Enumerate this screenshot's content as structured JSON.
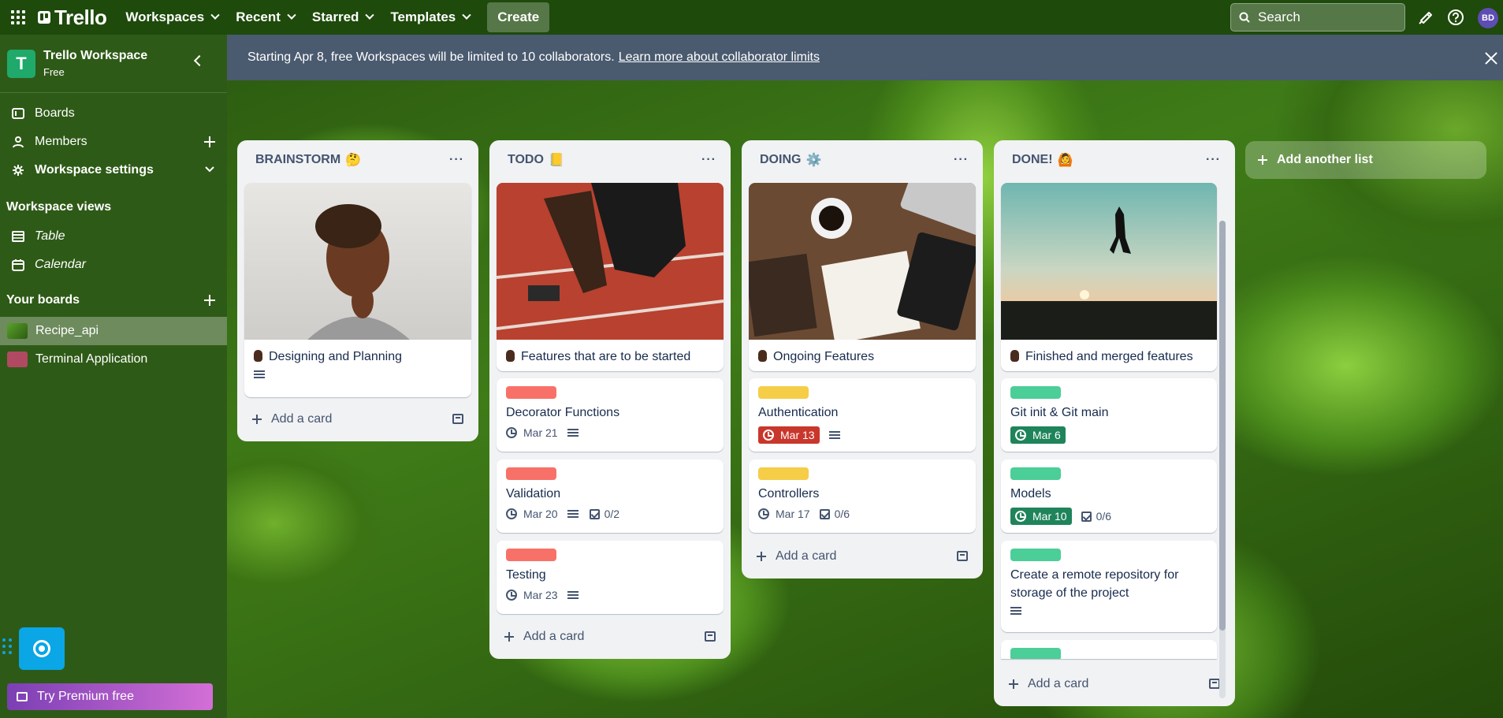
{
  "topbar": {
    "brand": "Trello",
    "nav": [
      "Workspaces",
      "Recent",
      "Starred",
      "Templates"
    ],
    "create_label": "Create",
    "search_placeholder": "Search",
    "avatar_initials": "BD"
  },
  "sidebar": {
    "workspace_initial": "T",
    "workspace_name": "Trello Workspace",
    "workspace_plan": "Free",
    "items": [
      {
        "label": "Boards",
        "icon": "board-icon"
      },
      {
        "label": "Members",
        "icon": "person-icon"
      },
      {
        "label": "Workspace settings",
        "icon": "gear-icon"
      }
    ],
    "views_title": "Workspace views",
    "views": [
      {
        "label": "Table",
        "icon": "table-icon"
      },
      {
        "label": "Calendar",
        "icon": "calendar-icon"
      }
    ],
    "boards_title": "Your boards",
    "boards": [
      {
        "label": "Recipe_api",
        "color": "#4b8a1f",
        "active": true
      },
      {
        "label": "Terminal Application",
        "color": "#b04a62",
        "active": false
      }
    ],
    "premium_label": "Try Premium free"
  },
  "banner": {
    "text": "Starting Apr 8, free Workspaces will be limited to 10 collaborators.",
    "link": "Learn more about collaborator limits"
  },
  "colors": {
    "label_red": "#f87168",
    "label_yellow": "#f5cd47",
    "label_green": "#4bce97",
    "due_overdue": "#c9372c",
    "due_complete": "#1f845a"
  },
  "lists": [
    {
      "title": "BRAINSTORM",
      "emoji": "🤔",
      "cover_card": {
        "title": "Designing and Planning",
        "has_description": true
      },
      "cards": [],
      "add_label": "Add a card"
    },
    {
      "title": "TODO",
      "emoji": "📒",
      "cover_card": {
        "title": "Features that are to be started",
        "has_description": false
      },
      "cards": [
        {
          "label_color": "red",
          "title": "Decorator Functions",
          "due": "Mar 21",
          "has_description": true,
          "checklist": ""
        },
        {
          "label_color": "red",
          "title": "Validation",
          "due": "Mar 20",
          "has_description": true,
          "checklist": "0/2"
        },
        {
          "label_color": "red",
          "title": "Testing",
          "due": "Mar 23",
          "has_description": true,
          "checklist": ""
        }
      ],
      "add_label": "Add a card"
    },
    {
      "title": "DOING",
      "emoji": "⚙️",
      "cover_card": {
        "title": "Ongoing Features",
        "has_description": false
      },
      "cards": [
        {
          "label_color": "yellow",
          "title": "Authentication",
          "due": "Mar 13",
          "due_state": "overdue",
          "has_description": true,
          "checklist": ""
        },
        {
          "label_color": "yellow",
          "title": "Controllers",
          "due": "Mar 17",
          "has_description": false,
          "checklist": "0/6"
        }
      ],
      "add_label": "Add a card"
    },
    {
      "title": "DONE!",
      "emoji": "🙆",
      "cover_card": {
        "title": "Finished and merged features",
        "has_description": false
      },
      "cards": [
        {
          "label_color": "green",
          "title": "Git init & Git main",
          "due": "Mar 6",
          "due_state": "complete",
          "has_description": false,
          "checklist": ""
        },
        {
          "label_color": "green",
          "title": "Models",
          "due": "Mar 10",
          "due_state": "complete",
          "has_description": false,
          "checklist": "0/6"
        },
        {
          "label_color": "green",
          "title": "Create a remote repository for storage of the project",
          "due": "",
          "has_description": true,
          "checklist": ""
        }
      ],
      "add_label": "Add a card"
    }
  ],
  "add_list_label": "Add another list"
}
